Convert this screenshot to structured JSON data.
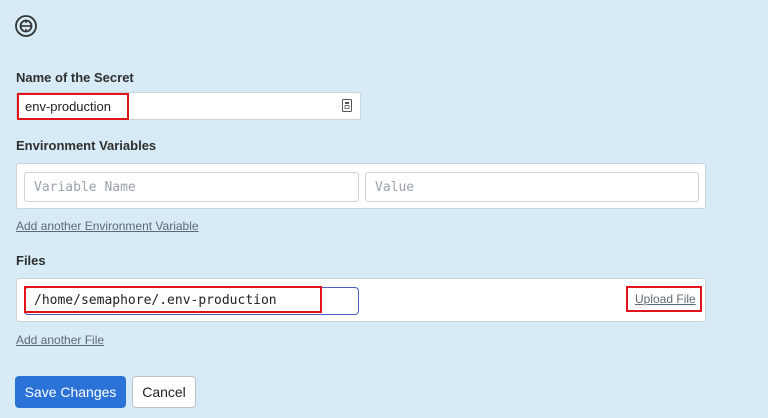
{
  "logo": {
    "icon": "semaphore-logo-icon"
  },
  "secret_name": {
    "label": "Name of the Secret",
    "value": "env-production",
    "field_icon": "password-manager-icon"
  },
  "env_vars": {
    "label": "Environment Variables",
    "name_placeholder": "Variable Name",
    "value_placeholder": "Value",
    "add_link": "Add another Environment Variable"
  },
  "files": {
    "label": "Files",
    "path_value": "/home/semaphore/.env-production",
    "upload_link": "Upload File",
    "add_link": "Add another File"
  },
  "actions": {
    "save_label": "Save Changes",
    "cancel_label": "Cancel"
  },
  "colors": {
    "background": "#d6ebf5",
    "primary": "#2b72d6",
    "highlight": "#e2141b",
    "focus_border": "#4a5fc1"
  }
}
